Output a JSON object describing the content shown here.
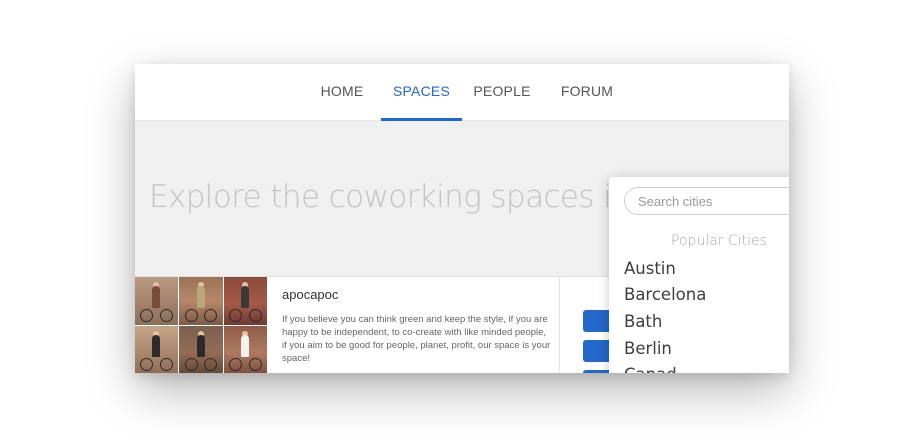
{
  "nav": {
    "items": [
      {
        "label": "HOME"
      },
      {
        "label": "SPACES"
      },
      {
        "label": "PEOPLE"
      },
      {
        "label": "FORUM"
      }
    ],
    "active_color": "#2468c9"
  },
  "hero": {
    "title": "Explore the coworking spaces in"
  },
  "card": {
    "title": "apocapoc",
    "description": "If you believe you can think green and keep the style, if you are happy to be independent, to co-create with like minded people, if you aim to be good for people, planet, profit, our space is your space!"
  },
  "city_search": {
    "placeholder": "Search cities",
    "heading": "Popular Cities",
    "cities": [
      "Austin",
      "Barcelona",
      "Bath",
      "Berlin",
      "Canad"
    ]
  }
}
